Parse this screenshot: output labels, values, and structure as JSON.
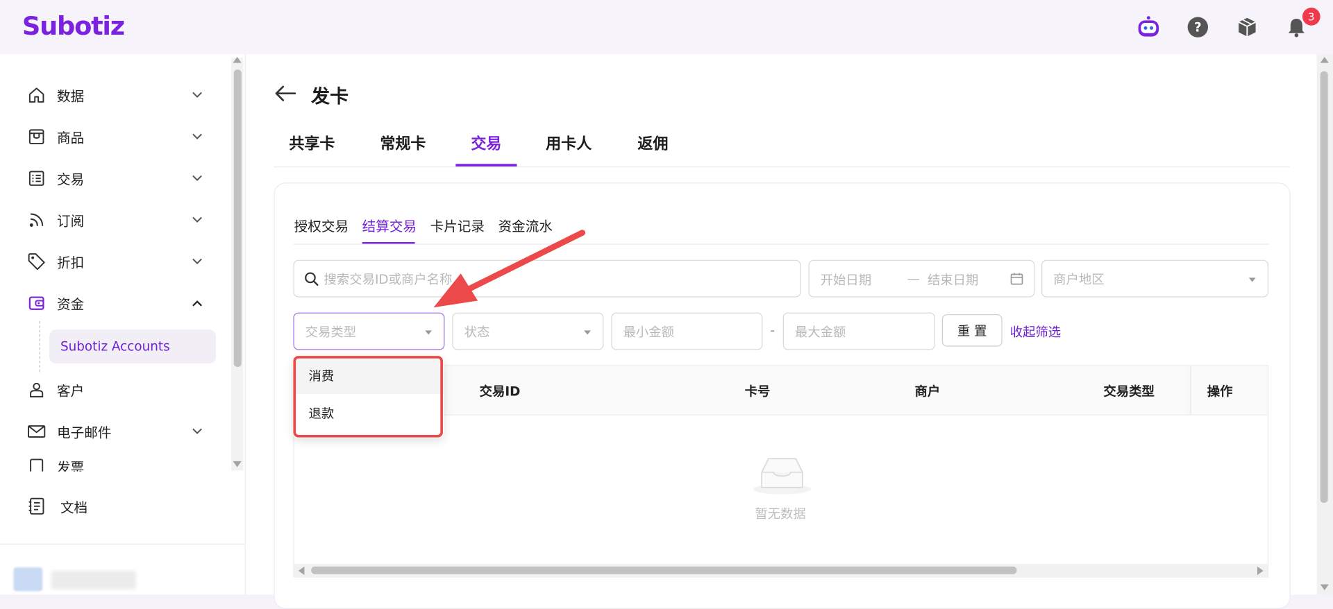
{
  "header": {
    "logo": "Subotiz",
    "icons": [
      "bot-icon",
      "help-icon",
      "box-icon",
      "bell-icon"
    ],
    "notification_count": "3"
  },
  "sidebar": {
    "items": [
      {
        "label": "数据",
        "icon": "home-icon",
        "expanded": false
      },
      {
        "label": "商品",
        "icon": "store-icon",
        "expanded": false
      },
      {
        "label": "交易",
        "icon": "list-icon",
        "expanded": false
      },
      {
        "label": "订阅",
        "icon": "rss-icon",
        "expanded": false
      },
      {
        "label": "折扣",
        "icon": "tag-icon",
        "expanded": false
      },
      {
        "label": "资金",
        "icon": "wallet-icon",
        "expanded": true
      },
      {
        "label": "客户",
        "icon": "user-icon"
      },
      {
        "label": "电子邮件",
        "icon": "mail-icon",
        "expanded": false
      },
      {
        "label": "发票",
        "icon": "invoice-icon",
        "expanded": false
      }
    ],
    "sub_items": [
      {
        "label": "Subotiz Accounts",
        "active": true
      }
    ],
    "docs_label": "文档"
  },
  "page": {
    "title": "发卡",
    "tabs": [
      {
        "label": "共享卡",
        "active": false
      },
      {
        "label": "常规卡",
        "active": false
      },
      {
        "label": "交易",
        "active": true
      },
      {
        "label": "用卡人",
        "active": false
      },
      {
        "label": "返佣",
        "active": false
      }
    ],
    "sub_tabs": [
      {
        "label": "授权交易",
        "active": false
      },
      {
        "label": "结算交易",
        "active": true
      },
      {
        "label": "卡片记录",
        "active": false
      },
      {
        "label": "资金流水",
        "active": false
      }
    ]
  },
  "filters": {
    "search_placeholder": "搜索交易ID或商户名称",
    "start_date_placeholder": "开始日期",
    "date_separator": "—",
    "end_date_placeholder": "结束日期",
    "region_placeholder": "商户地区",
    "txn_type_placeholder": "交易类型",
    "status_placeholder": "状态",
    "min_amount_placeholder": "最小金额",
    "amount_separator": "-",
    "max_amount_placeholder": "最大金额",
    "reset_label": "重 置",
    "collapse_label": "收起筛选"
  },
  "dropdown": {
    "options": [
      "消费",
      "退款"
    ]
  },
  "table": {
    "columns": [
      "交易ID",
      "卡号",
      "商户",
      "交易类型",
      "操作"
    ],
    "empty_text": "暂无数据"
  },
  "colors": {
    "accent": "#7a22dd",
    "annotation": "#ec4a4a",
    "badge": "#f0394a"
  }
}
